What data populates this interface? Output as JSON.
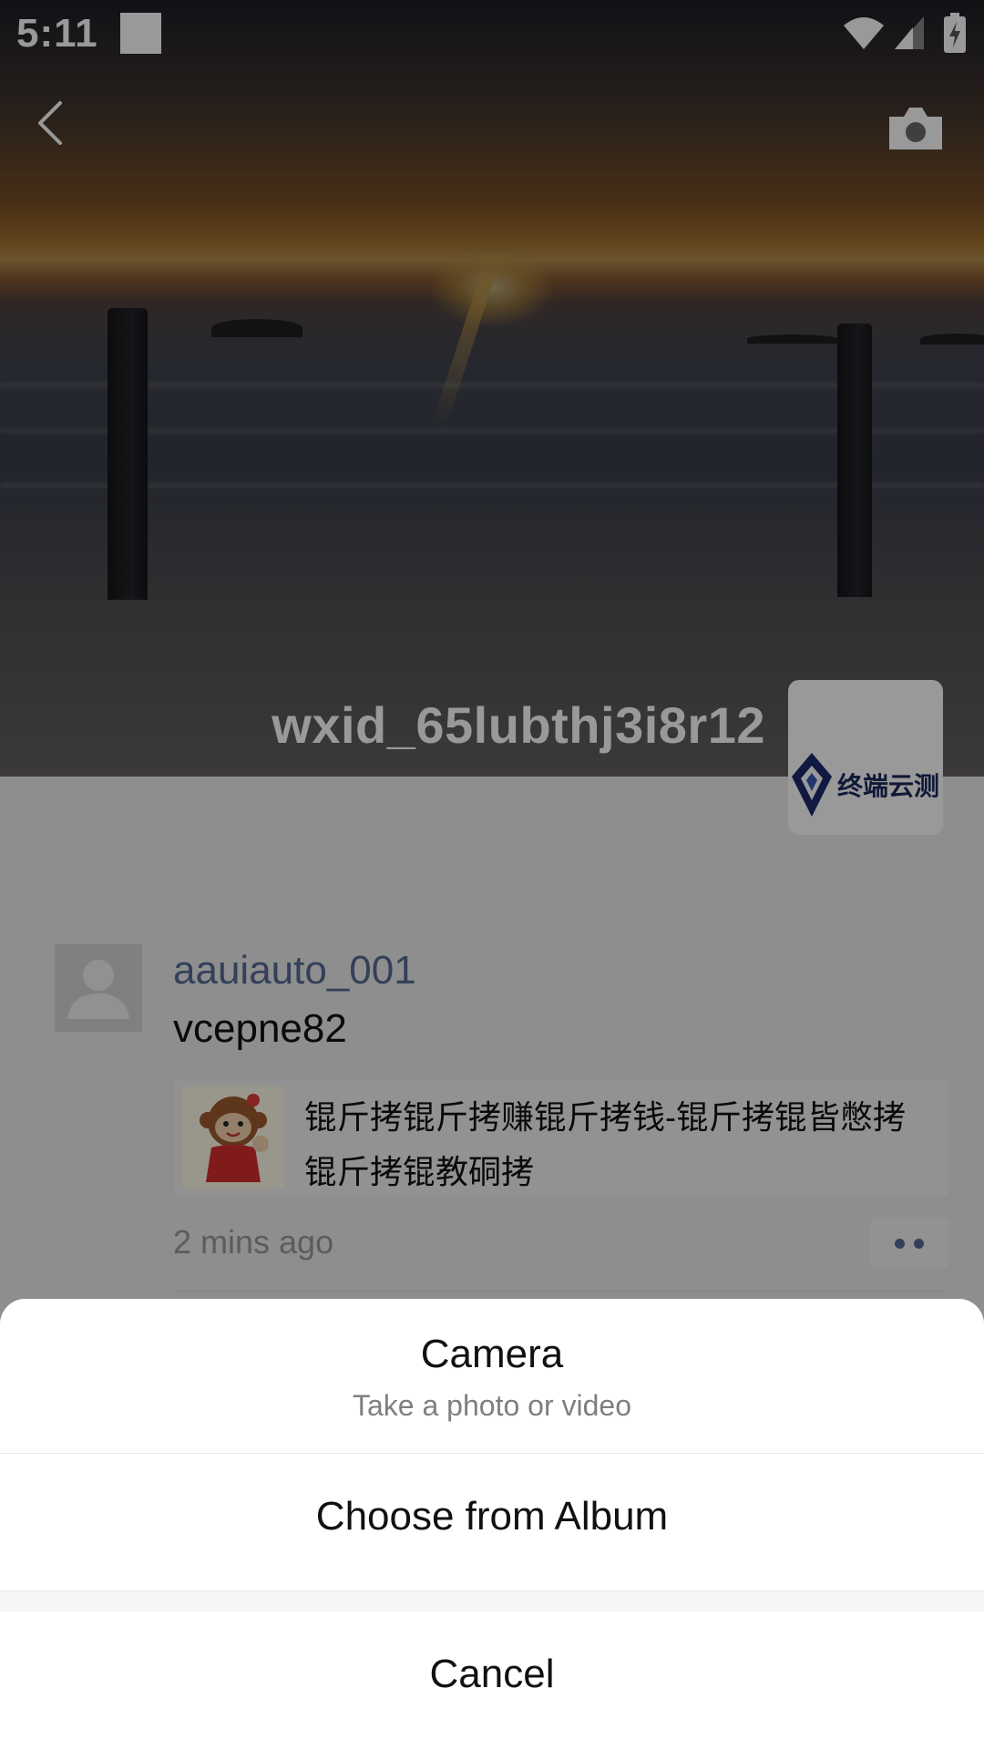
{
  "status_bar": {
    "time": "5:11",
    "icons": [
      "notification-square-icon",
      "wifi-icon",
      "cellular-signal-icon",
      "battery-charging-icon"
    ]
  },
  "header": {
    "back_icon": "chevron-left-icon",
    "camera_icon": "camera-icon"
  },
  "profile": {
    "username": "wxid_65lubthj3i8r12",
    "avatar_logo_text": "终端云测"
  },
  "feed": {
    "posts": [
      {
        "author": "aauiauto_001",
        "text": "vcepne82",
        "shared_link_title": "锟斤拷锟斤拷赚锟斤拷钱-锟斤拷锟皆憋拷锟斤拷锟教硐拷",
        "time": "2 mins ago"
      }
    ]
  },
  "action_sheet": {
    "camera_title": "Camera",
    "camera_subtitle": "Take a photo or video",
    "album_label": "Choose from Album",
    "cancel_label": "Cancel"
  },
  "colors": {
    "link_blue": "#576b95",
    "overlay": "rgba(0,0,0,0.40)",
    "sheet_background": "#ffffff",
    "feed_background": "#ededed"
  }
}
